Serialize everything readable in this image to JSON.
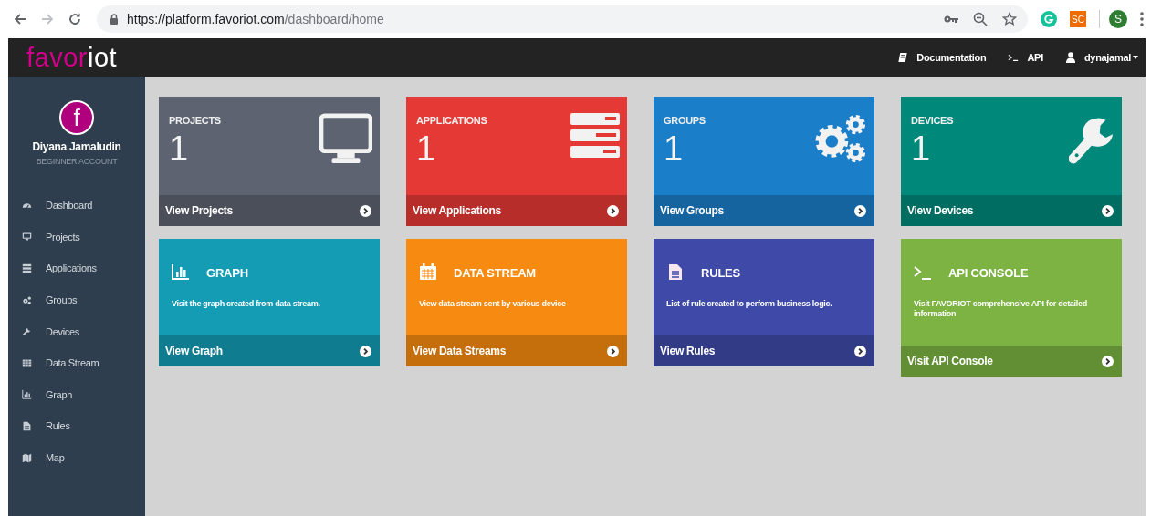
{
  "browser": {
    "url_host": "https://platform.favoriot.com",
    "url_path": "/dashboard/home",
    "forward_disabled": true,
    "extensions": [
      {
        "kind": "circle",
        "color": "#15c39a"
      },
      {
        "kind": "square",
        "label": "SC",
        "color": "#ef6c00"
      },
      {
        "kind": "profile",
        "label": "S",
        "color": "#2e7d32"
      }
    ]
  },
  "header": {
    "logo_main": "favor",
    "logo_end": "iot",
    "links": [
      {
        "kind": "doc",
        "label": "Documentation"
      },
      {
        "kind": "api",
        "label": "API"
      },
      {
        "kind": "user",
        "label": "dynajamal",
        "dropdown": true
      }
    ]
  },
  "sidebar": {
    "avatar_letter": "f",
    "user_name": "Diyana Jamaludin",
    "account_type": "BEGINNER ACCOUNT",
    "items": [
      {
        "label": "Dashboard"
      },
      {
        "label": "Projects"
      },
      {
        "label": "Applications"
      },
      {
        "label": "Groups"
      },
      {
        "label": "Devices"
      },
      {
        "label": "Data Stream"
      },
      {
        "label": "Graph"
      },
      {
        "label": "Rules"
      },
      {
        "label": "Map"
      }
    ]
  },
  "cards": [
    {
      "kind": "stat",
      "title": "PROJECTS",
      "count": "1",
      "link": "View Projects",
      "color": "#5d6371"
    },
    {
      "kind": "stat",
      "title": "APPLICATIONS",
      "count": "1",
      "link": "View Applications",
      "color": "#e53935"
    },
    {
      "kind": "stat",
      "title": "GROUPS",
      "count": "1",
      "link": "View Groups",
      "color": "#1b7ec8"
    },
    {
      "kind": "stat",
      "title": "DEVICES",
      "count": "1",
      "link": "View Devices",
      "color": "#00897b"
    },
    {
      "kind": "info",
      "title": "GRAPH",
      "description": "Visit the graph created from data stream.",
      "link": "View Graph",
      "color": "#149cb5"
    },
    {
      "kind": "info",
      "title": "DATA STREAM",
      "description": "View data stream sent by various device",
      "link": "View Data Streams",
      "color": "#f78a10"
    },
    {
      "kind": "info",
      "title": "RULES",
      "description": "List of rule created to perform business logic.",
      "link": "View Rules",
      "color": "#3f4aa8"
    },
    {
      "kind": "info",
      "title": "API CONSOLE",
      "description": "Visit FAVORIOT comprehensive API for detailed information",
      "link": "Visit API Console",
      "color": "#7cb342"
    }
  ]
}
